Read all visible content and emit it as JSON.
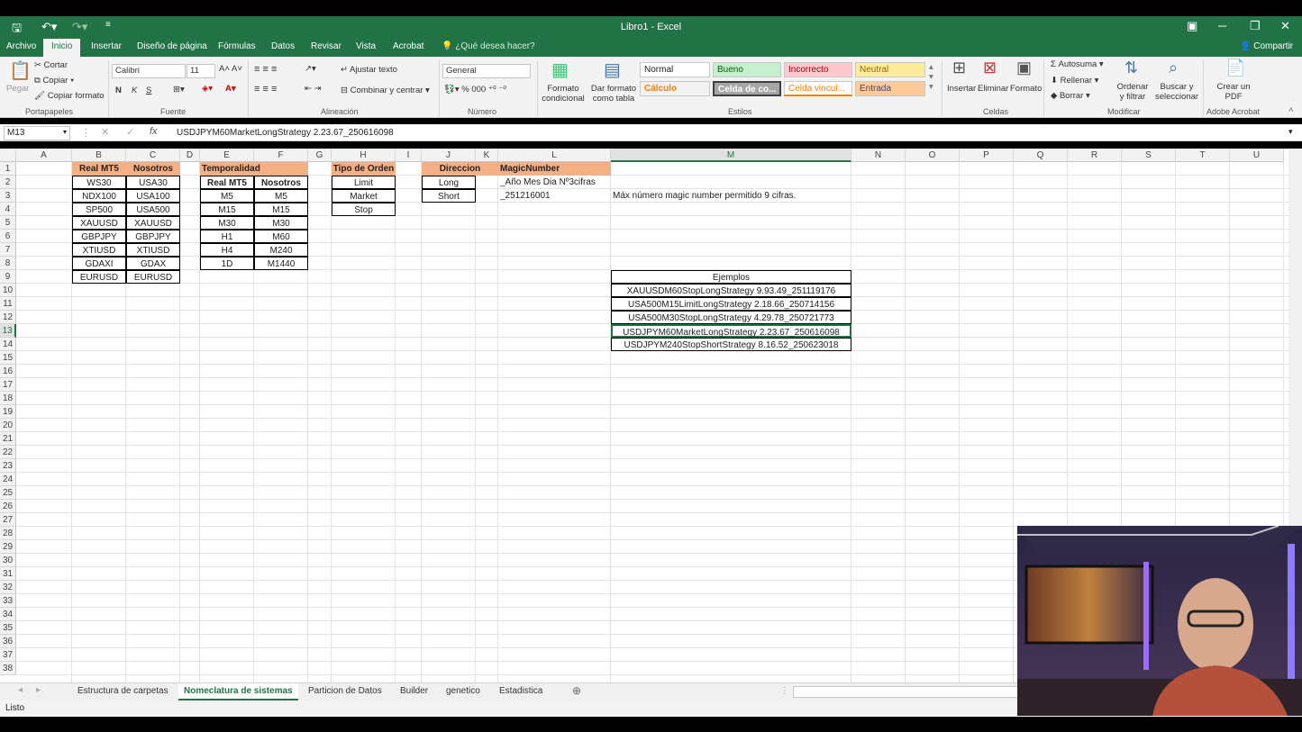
{
  "window": {
    "title": "Libro1 - Excel"
  },
  "tabs": [
    "Archivo",
    "Inicio",
    "Insertar",
    "Diseño de página",
    "Fórmulas",
    "Datos",
    "Revisar",
    "Vista",
    "Acrobat"
  ],
  "tellme": "¿Qué desea hacer?",
  "share": "Compartir",
  "ribbon": {
    "paste": "Pegar",
    "cut": "Cortar",
    "copy": "Copiar",
    "format_painter": "Copiar formato",
    "font_name": "Calibri",
    "font_size": "11",
    "bold": "N",
    "italic": "K",
    "underline": "S",
    "wrap": "Ajustar texto",
    "merge": "Combinar y centrar",
    "number_format": "General",
    "cond_format": "Formato condicional",
    "format_table": "Dar formato como tabla",
    "insert": "Insertar",
    "delete": "Eliminar",
    "format": "Formato",
    "autosum": "Autosuma",
    "fill": "Rellenar",
    "clear": "Borrar",
    "sort": "Ordenar y filtrar",
    "find": "Buscar y seleccionar",
    "pdf": "Crear un PDF",
    "styles": {
      "normal": "Normal",
      "good": "Bueno",
      "bad": "Incorrecto",
      "neutral": "Neutral",
      "calc": "Cálculo",
      "check": "Celda de co...",
      "linked": "Celda vincul...",
      "input": "Entrada"
    },
    "groups": {
      "clipboard": "Portapapeles",
      "font": "Fuente",
      "align": "Alineación",
      "number": "Número",
      "styles": "Estilos",
      "cells": "Celdas",
      "edit": "Modificar",
      "acrobat": "Adobe Acrobat"
    }
  },
  "formula": {
    "cell": "M13",
    "content": "USDJPYM60MarketLongStrategy 2.23.67_250616098"
  },
  "columns": [
    "A",
    "B",
    "C",
    "D",
    "E",
    "F",
    "G",
    "H",
    "I",
    "J",
    "K",
    "L",
    "M",
    "N",
    "O",
    "P",
    "Q",
    "R",
    "S",
    "T",
    "U"
  ],
  "rows": [
    "1",
    "2",
    "3",
    "4",
    "5",
    "6",
    "7",
    "8",
    "9",
    "10",
    "11",
    "12",
    "13",
    "14",
    "15",
    "16",
    "17",
    "18",
    "19",
    "20",
    "21",
    "22",
    "23",
    "24",
    "25",
    "26",
    "27",
    "28",
    "29",
    "30",
    "31",
    "32",
    "33",
    "34",
    "35",
    "36",
    "37",
    "38"
  ],
  "cells": {
    "b_hdr": "Real MT5",
    "c_hdr": "Nosotros",
    "b": [
      "WS30",
      "NDX100",
      "SP500",
      "XAUUSD",
      "GBPJPY",
      "XTIUSD",
      "GDAXI",
      "EURUSD"
    ],
    "c": [
      "USA30",
      "USA100",
      "USA500",
      "XAUUSD",
      "GBPJPY",
      "XTIUSD",
      "GDAX",
      "EURUSD"
    ],
    "e_title": "Temporalidad",
    "e_hdr": "Real MT5",
    "f_hdr": "Nosotros",
    "e": [
      "M5",
      "M15",
      "M30",
      "H1",
      "H4",
      "1D"
    ],
    "f": [
      "M5",
      "M15",
      "M30",
      "M60",
      "M240",
      "M1440"
    ],
    "h_hdr": "Tipo de Orden",
    "h": [
      "Limit",
      "Market",
      "Stop"
    ],
    "j_hdr": "Direccion",
    "j": [
      "Long",
      "Short"
    ],
    "l_hdr": "MagicNumber",
    "l2": "_Año Mes Dia Nº3cifras",
    "l3": "_251216001",
    "m3": "Máx número magic number permitido 9 cifras.",
    "m9": "Ejemplos",
    "examples": [
      "XAUUSDM60StopLongStrategy 9.93.49_251119176",
      "USA500M15LimitLongStrategy 2.18.66_250714156",
      "USA500M30StopLongStrategy 4.29.78_250721773",
      "USDJPYM60MarketLongStrategy 2.23.67_250616098",
      "USDJPYM240StopShortStrategy 8.16.52_250623018"
    ]
  },
  "sheets": [
    "Estructura de carpetas",
    "Nomeclatura de sistemas",
    "Particion de Datos",
    "Builder",
    "genetico",
    "Estadistica"
  ],
  "status": "Listo"
}
